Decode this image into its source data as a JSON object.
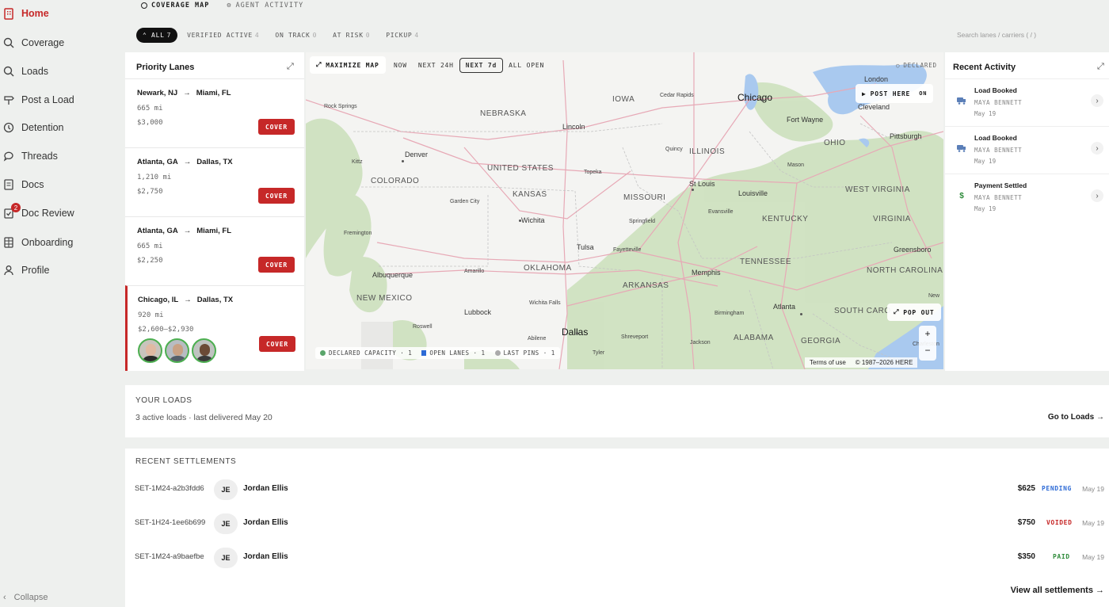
{
  "sidebar": {
    "items": [
      {
        "label": "Home",
        "icon": "building-icon",
        "active": true
      },
      {
        "label": "Coverage",
        "icon": "search-icon"
      },
      {
        "label": "Loads",
        "icon": "search-icon"
      },
      {
        "label": "Post a Load",
        "icon": "signpost-icon"
      },
      {
        "label": "Detention",
        "icon": "clock-icon"
      },
      {
        "label": "Threads",
        "icon": "chat-icon"
      },
      {
        "label": "Docs",
        "icon": "document-icon"
      },
      {
        "label": "Doc Review",
        "icon": "checklist-icon",
        "badge": "2"
      },
      {
        "label": "Onboarding",
        "icon": "grid-icon"
      },
      {
        "label": "Profile",
        "icon": "user-icon"
      }
    ],
    "collapse_label": "Collapse"
  },
  "topnav": {
    "coverage_map": "COVERAGE MAP",
    "agent_activity": "AGENT ACTIVITY"
  },
  "filters": [
    {
      "label": "ALL",
      "count": "7",
      "active": true
    },
    {
      "label": "VERIFIED ACTIVE",
      "count": "4"
    },
    {
      "label": "ON TRACK",
      "count": "0"
    },
    {
      "label": "AT RISK",
      "count": "0"
    },
    {
      "label": "PICKUP",
      "count": "4"
    }
  ],
  "search_placeholder": "Search lanes / carriers ( / )",
  "priority": {
    "title": "Priority Lanes",
    "cover_label": "COVER",
    "lanes": [
      {
        "origin": "Newark, NJ",
        "dest": "Miami, FL",
        "miles": "665 mi",
        "price": "$3,000"
      },
      {
        "origin": "Atlanta, GA",
        "dest": "Dallas, TX",
        "miles": "1,210 mi",
        "price": "$2,750"
      },
      {
        "origin": "Atlanta, GA",
        "dest": "Miami, FL",
        "miles": "665 mi",
        "price": "$2,250"
      },
      {
        "origin": "Chicago, IL",
        "dest": "Dallas, TX",
        "miles": "920 mi",
        "price": "$2,600–$2,930",
        "selected": true
      }
    ]
  },
  "map": {
    "maximize_label": "MAXIMIZE MAP",
    "tabs": [
      "NOW",
      "NEXT 24H",
      "NEXT 7d",
      "ALL OPEN"
    ],
    "active_tab": "NEXT 7d",
    "declared_label": "DECLARED",
    "post_here": "POST HERE",
    "post_toggle": "ON",
    "pop_out": "POP OUT",
    "legend": [
      "DECLARED CAPACITY · 1",
      "OPEN LANES · 1",
      "LAST PINS · 1"
    ],
    "zoom_in": "+",
    "zoom_out": "−",
    "terms": "Terms of use",
    "copyright": "© 1987–2026 HERE",
    "labels": {
      "nebraska": "NEBRASKA",
      "iowa": "IOWA",
      "illinois": "ILLINOIS",
      "ohio": "OHIO",
      "colorado": "COLORADO",
      "united_states": "UNITED STATES",
      "kansas": "KANSAS",
      "missouri": "MISSOURI",
      "kentucky": "KENTUCKY",
      "west_virginia": "WEST VIRGINIA",
      "virginia": "VIRGINIA",
      "tennessee": "TENNESSEE",
      "north_carolina": "NORTH CAROLINA",
      "oklahoma": "OKLAHOMA",
      "arkansas": "ARKANSAS",
      "new_mexico": "NEW MEXICO",
      "south_carolina": "SOUTH CARO",
      "alabama": "ALABAMA",
      "georgia": "GEORGIA",
      "chicago": "Chicago",
      "denver": "Denver",
      "lincoln": "Lincoln",
      "fort_wayne": "Fort Wayne",
      "cleveland": "Cleveland",
      "london": "London",
      "pittsburgh": "Pittsburgh",
      "cedar_rapids": "Cedar Rapids",
      "rock_springs": "Rock Springs",
      "topeka": "Topeka",
      "st_louis": "St Louis",
      "louisville": "Louisville",
      "wichita": "Wichita",
      "springfield": "Springfield",
      "tulsa": "Tulsa",
      "memphis": "Memphis",
      "albuquerque": "Albuquerque",
      "amarillo": "Amarillo",
      "lubbock": "Lubbock",
      "dallas": "Dallas",
      "atlanta": "Atlanta",
      "greensboro": "Greensboro",
      "birmingham": "Birmingham",
      "jackson": "Jackson",
      "shreveport": "Shreveport",
      "wichita_falls": "Wichita Falls",
      "abilene": "Abilene",
      "tyler": "Tyler",
      "roswell": "Roswell",
      "frementon": "Fremington",
      "garden_city": "Garden City",
      "fayetteville": "Fayetteville",
      "evansville": "Evansville",
      "quincy": "Quincy",
      "mason": "Mason",
      "charleston": "Charleston",
      "kittz": "Kittz",
      "new": "New"
    }
  },
  "activity": {
    "title": "Recent Activity",
    "items": [
      {
        "title": "Load Booked",
        "user": "MAYA BENNETT",
        "date": "May 19",
        "icon": "truck-icon"
      },
      {
        "title": "Load Booked",
        "user": "MAYA BENNETT",
        "date": "May 19",
        "icon": "truck-icon"
      },
      {
        "title": "Payment Settled",
        "user": "MAYA BENNETT",
        "date": "May 19",
        "icon": "dollar-icon"
      }
    ]
  },
  "loads": {
    "title": "YOUR LOADS",
    "summary": "3 active loads · last delivered May 20",
    "link": "Go to Loads →"
  },
  "settlements": {
    "title": "RECENT SETTLEMENTS",
    "rows": [
      {
        "id": "SET-1M24-a2b3fdd6",
        "initials": "JE",
        "name": "Jordan Ellis",
        "amount": "$625",
        "status": "PENDING",
        "status_color": "#2e6bd6",
        "date": "May 19"
      },
      {
        "id": "SET-1H24-1ee6b699",
        "initials": "JE",
        "name": "Jordan Ellis",
        "amount": "$750",
        "status": "VOIDED",
        "status_color": "#c62828",
        "date": "May 19"
      },
      {
        "id": "SET-1M24-a9baefbe",
        "initials": "JE",
        "name": "Jordan Ellis",
        "amount": "$350",
        "status": "PAID",
        "status_color": "#2e8b3a",
        "date": "May 19"
      }
    ],
    "view_all": "View all settlements →"
  }
}
